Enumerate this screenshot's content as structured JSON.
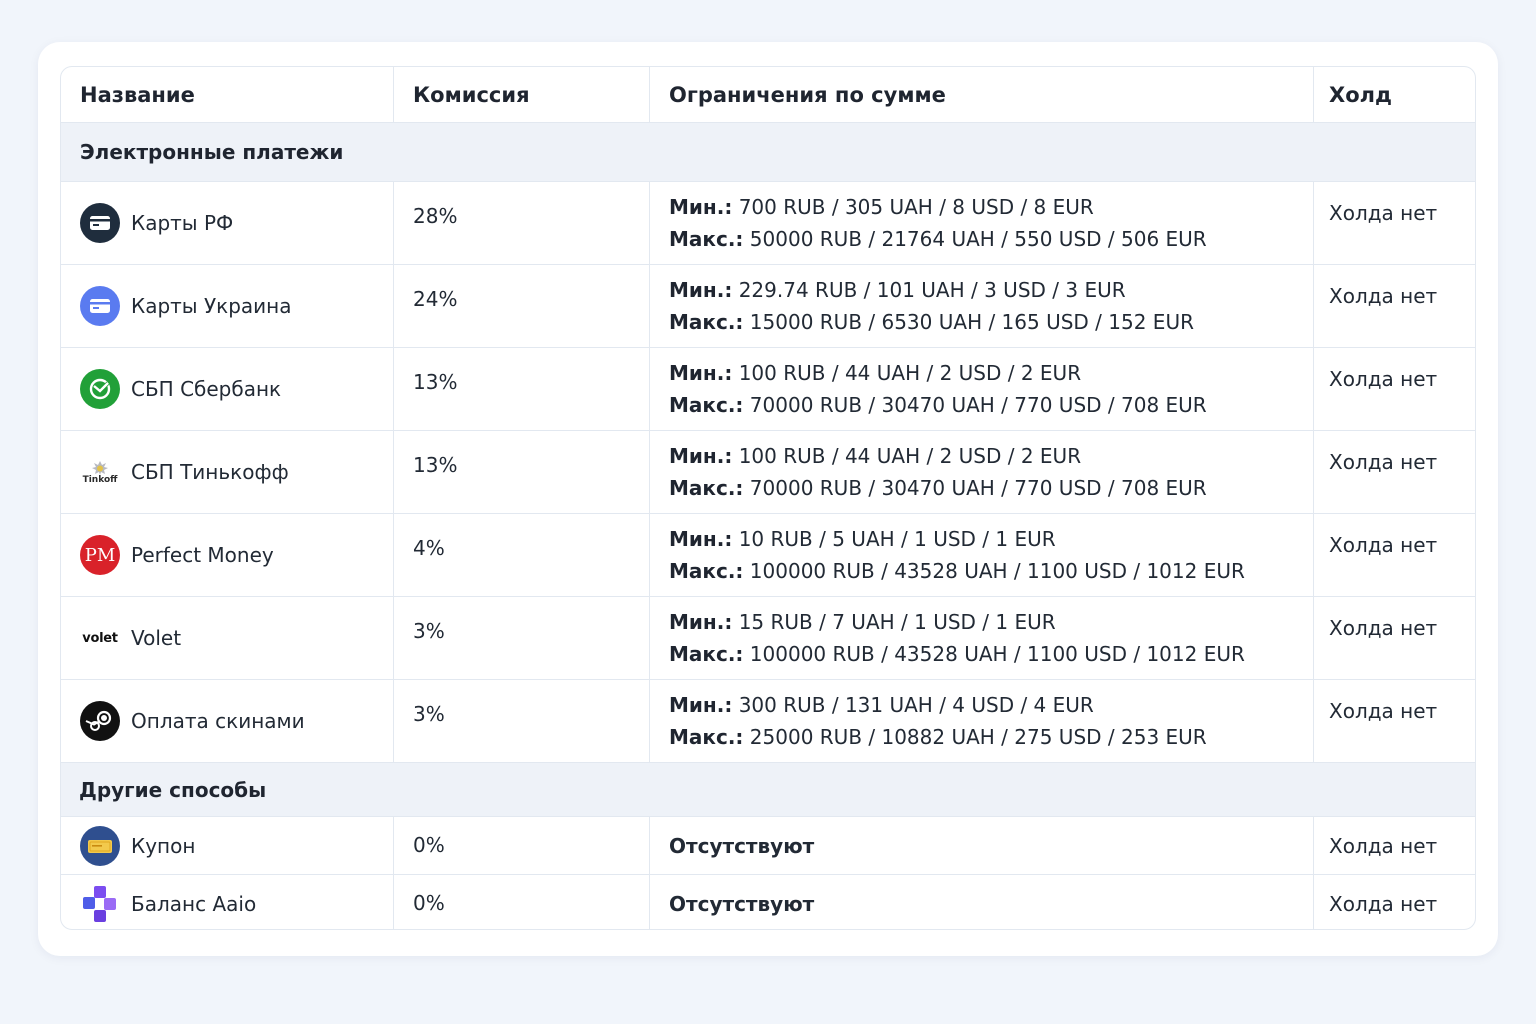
{
  "headers": {
    "name": "Название",
    "commission": "Комиссия",
    "limits": "Ограничения по сумме",
    "hold": "Холд"
  },
  "sections": [
    {
      "title": "Электронные платежи",
      "rows": [
        {
          "name": "Карты РФ",
          "icon": "card-icon",
          "commission": "28%",
          "min_label": "Мин.:",
          "min": "700 RUB / 305 UAH / 8 USD / 8 EUR",
          "max_label": "Макс.:",
          "max": "50000 RUB / 21764 UAH / 550 USD / 506 EUR",
          "hold": "Холда нет"
        },
        {
          "name": "Карты Украина",
          "icon": "card-icon",
          "commission": "24%",
          "min_label": "Мин.:",
          "min": "229.74 RUB / 101 UAH / 3 USD / 3 EUR",
          "max_label": "Макс.:",
          "max": "15000 RUB / 6530 UAH / 165 USD / 152 EUR",
          "hold": "Холда нет"
        },
        {
          "name": "СБП Сбербанк",
          "icon": "sberbank-logo-icon",
          "commission": "13%",
          "min_label": "Мин.:",
          "min": "100 RUB / 44 UAH / 2 USD / 2 EUR",
          "max_label": "Макс.:",
          "max": "70000 RUB / 30470 UAH / 770 USD / 708 EUR",
          "hold": "Холда нет"
        },
        {
          "name": "СБП Тинькофф",
          "icon": "tinkoff-logo-icon",
          "logo_text": "Tinkoff",
          "commission": "13%",
          "min_label": "Мин.:",
          "min": "100 RUB / 44 UAH / 2 USD / 2 EUR",
          "max_label": "Макс.:",
          "max": "70000 RUB / 30470 UAH / 770 USD / 708 EUR",
          "hold": "Холда нет"
        },
        {
          "name": "Perfect Money",
          "icon": "perfect-money-logo-icon",
          "logo_text": "PM",
          "commission": "4%",
          "min_label": "Мин.:",
          "min": "10 RUB / 5 UAH / 1 USD / 1 EUR",
          "max_label": "Макс.:",
          "max": "100000 RUB / 43528 UAH / 1100 USD / 1012 EUR",
          "hold": "Холда нет"
        },
        {
          "name": "Volet",
          "icon": "volet-logo-icon",
          "logo_text": "volet",
          "commission": "3%",
          "min_label": "Мин.:",
          "min": "15 RUB / 7 UAH / 1 USD / 1 EUR",
          "max_label": "Макс.:",
          "max": "100000 RUB / 43528 UAH / 1100 USD / 1012 EUR",
          "hold": "Холда нет"
        },
        {
          "name": "Оплата скинами",
          "icon": "steam-logo-icon",
          "commission": "3%",
          "min_label": "Мин.:",
          "min": "300 RUB / 131 UAH / 4 USD / 4 EUR",
          "max_label": "Макс.:",
          "max": "25000 RUB / 10882 UAH / 275 USD / 253 EUR",
          "hold": "Холда нет"
        }
      ]
    },
    {
      "title": "Другие способы",
      "rows": [
        {
          "name": "Купон",
          "icon": "coupon-icon",
          "commission": "0%",
          "limits": "Отсутствуют",
          "hold": "Холда нет"
        },
        {
          "name": "Баланс Aaio",
          "icon": "aaio-logo-icon",
          "commission": "0%",
          "limits": "Отсутствуют",
          "hold": "Холда нет"
        }
      ]
    }
  ],
  "colors": {
    "card_rf": "#1f2d3d",
    "card_ua": "#5a7bf0",
    "sber": "#21a038",
    "perfect_money": "#d9222a",
    "steam": "#111111",
    "coupon": "#2f4f8f",
    "aaio": "#7b4df0"
  }
}
